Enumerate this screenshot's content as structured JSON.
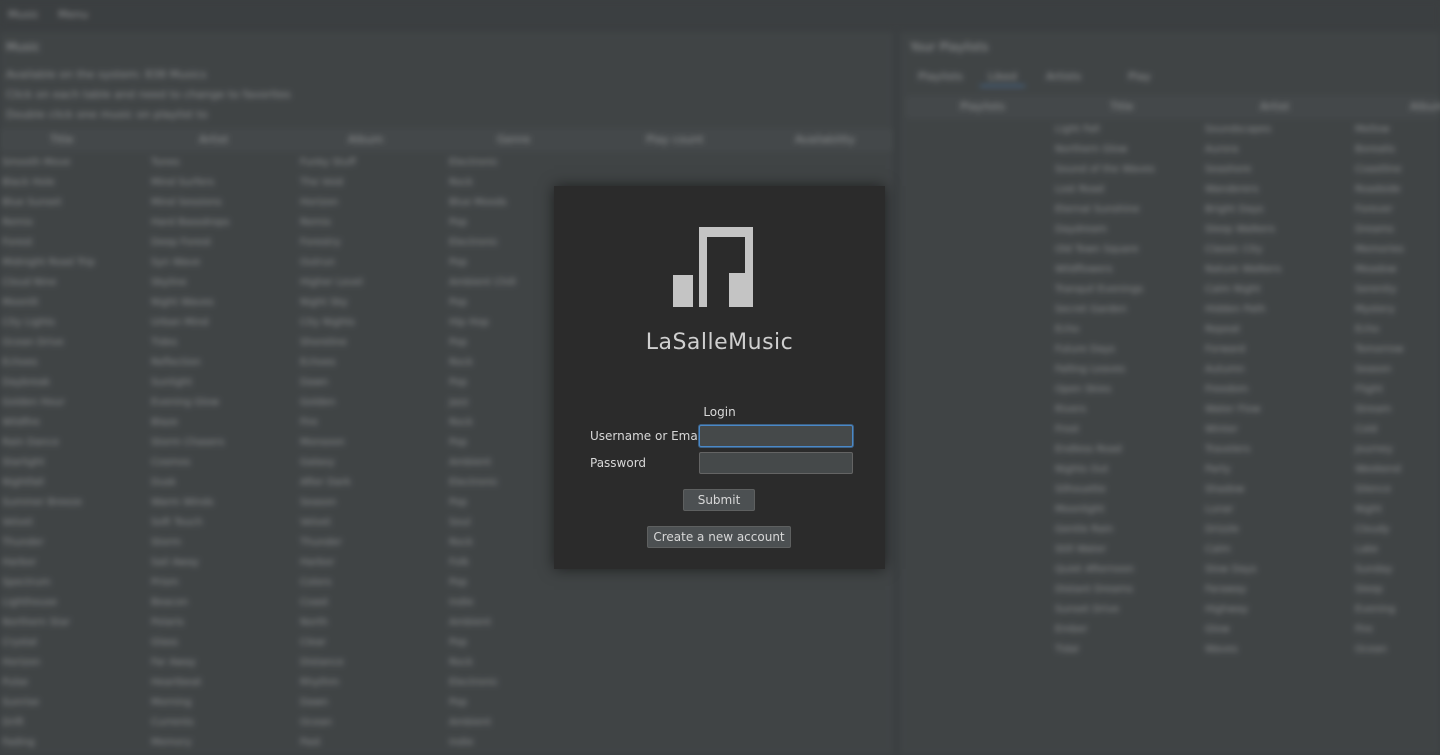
{
  "background": {
    "menu": [
      "Music",
      "Menu"
    ],
    "left_title": "Music",
    "left_subs": [
      "Available on the system: 838 Musics",
      "Click on each table and need to change to favorites",
      "Double click one music on playlist to"
    ],
    "left_columns": [
      "Title",
      "Artist",
      "Album",
      "Genre",
      "Play count",
      "Availability"
    ],
    "rows": [
      [
        "Smooth Move",
        "Tunes",
        "Funky Stuff",
        "Electronic"
      ],
      [
        "Black Hole",
        "Mind Surfers",
        "The Void",
        "Rock"
      ],
      [
        "Blue Sunset",
        "Mind Sessions",
        "Horizon",
        "Blue Moods"
      ],
      [
        "Remix",
        "Hard Bassdrops",
        "Remix",
        "Pop"
      ],
      [
        "Forest",
        "Deep Forest",
        "Forestry",
        "Electronic"
      ],
      [
        "Midnight Road Trip",
        "Syn Wave",
        "Outrun",
        "Pop"
      ],
      [
        "Cloud Nine",
        "Skyline",
        "Higher Level",
        "Ambient Chill"
      ],
      [
        "Moonlit",
        "Night Waves",
        "Night Sky",
        "Pop"
      ],
      [
        "City Lights",
        "Urban Mind",
        "City Nights",
        "Hip Hop"
      ],
      [
        "Ocean Drive",
        "Tides",
        "Shoreline",
        "Pop"
      ],
      [
        "Echoes",
        "Reflection",
        "Echoes",
        "Rock"
      ],
      [
        "Daybreak",
        "Sunlight",
        "Dawn",
        "Pop"
      ],
      [
        "Golden Hour",
        "Evening Glow",
        "Golden",
        "Jazz"
      ],
      [
        "Wildfire",
        "Blaze",
        "Fire",
        "Rock"
      ],
      [
        "Rain Dance",
        "Storm Chasers",
        "Monsoon",
        "Pop"
      ],
      [
        "Starlight",
        "Cosmos",
        "Galaxy",
        "Ambient"
      ],
      [
        "Nightfall",
        "Dusk",
        "After Dark",
        "Electronic"
      ],
      [
        "Summer Breeze",
        "Warm Winds",
        "Season",
        "Pop"
      ],
      [
        "Velvet",
        "Soft Touch",
        "Velvet",
        "Soul"
      ],
      [
        "Thunder",
        "Storm",
        "Thunder",
        "Rock"
      ],
      [
        "Harbor",
        "Sail Away",
        "Harbor",
        "Folk"
      ],
      [
        "Spectrum",
        "Prism",
        "Colors",
        "Pop"
      ],
      [
        "Lighthouse",
        "Beacon",
        "Coast",
        "Indie"
      ],
      [
        "Northern Star",
        "Polaris",
        "North",
        "Ambient"
      ],
      [
        "Crystal",
        "Glass",
        "Clear",
        "Pop"
      ],
      [
        "Horizon",
        "Far Away",
        "Distance",
        "Rock"
      ],
      [
        "Pulse",
        "Heartbeat",
        "Rhythm",
        "Electronic"
      ],
      [
        "Sunrise",
        "Morning",
        "Dawn",
        "Pop"
      ],
      [
        "Drift",
        "Currents",
        "Ocean",
        "Ambient"
      ],
      [
        "Fading",
        "Memory",
        "Past",
        "Indie"
      ]
    ],
    "right_title": "Your Playlists",
    "tabs": [
      "Playlists",
      "Liked",
      "Artists",
      "Play"
    ],
    "right_columns": [
      "Playlists",
      "Title",
      "Artist",
      "Album"
    ],
    "right_rows": [
      [
        "Light Fall",
        "Soundscapes",
        "Mellow"
      ],
      [
        "Northern Glow",
        "Aurora",
        "Borealis"
      ],
      [
        "Sound of the Waves",
        "Seashore",
        "Coastline"
      ],
      [
        "Lost Road",
        "Wanderers",
        "Roadside"
      ],
      [
        "Eternal Sunshine",
        "Bright Days",
        "Forever"
      ],
      [
        "Daydream",
        "Sleep Walkers",
        "Dreams"
      ],
      [
        "Old Town Square",
        "Classic City",
        "Memories"
      ],
      [
        "Wildflowers",
        "Nature Walkers",
        "Meadow"
      ],
      [
        "Tranquil Evenings",
        "Calm Night",
        "Serenity"
      ],
      [
        "Secret Garden",
        "Hidden Path",
        "Mystery"
      ],
      [
        "Echo",
        "Repeat",
        "Echo"
      ],
      [
        "Future Days",
        "Forward",
        "Tomorrow"
      ],
      [
        "Falling Leaves",
        "Autumn",
        "Season"
      ],
      [
        "Open Skies",
        "Freedom",
        "Flight"
      ],
      [
        "Rivers",
        "Water Flow",
        "Stream"
      ],
      [
        "Frost",
        "Winter",
        "Cold"
      ],
      [
        "Endless Road",
        "Travelers",
        "Journey"
      ],
      [
        "Nights Out",
        "Party",
        "Weekend"
      ],
      [
        "Silhouette",
        "Shadow",
        "Silence"
      ],
      [
        "Moonlight",
        "Lunar",
        "Night"
      ],
      [
        "Gentle Rain",
        "Drizzle",
        "Cloudy"
      ],
      [
        "Still Water",
        "Calm",
        "Lake"
      ],
      [
        "Quiet Afternoon",
        "Slow Days",
        "Sunday"
      ],
      [
        "Distant Dreams",
        "Faraway",
        "Sleep"
      ],
      [
        "Sunset Drive",
        "Highway",
        "Evening"
      ],
      [
        "Ember",
        "Glow",
        "Fire"
      ],
      [
        "Tidal",
        "Waves",
        "Ocean"
      ]
    ]
  },
  "dialog": {
    "app_name": "LaSalleMusic",
    "login_heading": "Login",
    "username_label": "Username or Email",
    "username_value": "",
    "password_label": "Password",
    "password_value": "",
    "submit_label": "Submit",
    "create_account_label": "Create a new account"
  },
  "colors": {
    "dialog_bg": "#2b2b2b",
    "focus_accent": "#4a88c7",
    "logo": "#c4c4c4"
  },
  "icons": {
    "logo": "music-note-logo-icon"
  }
}
